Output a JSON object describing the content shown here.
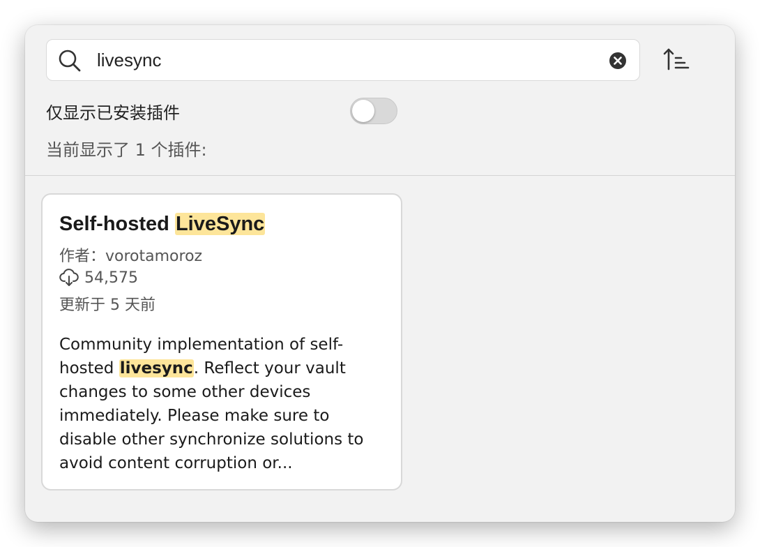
{
  "search": {
    "value": "livesync",
    "placeholder": ""
  },
  "filter": {
    "installed_only_label": "仅显示已安装插件",
    "installed_only_on": false
  },
  "result_count_text": "当前显示了 1 个插件:",
  "plugins": [
    {
      "title_prefix": "Self-hosted ",
      "title_highlight": "LiveSync",
      "author_label": "作者：",
      "author": "vorotamoroz",
      "downloads": "54,575",
      "updated": "更新于 5 天前",
      "description_before": "Community implementation of self-hosted ",
      "description_highlight": "livesync",
      "description_after": ". Reflect your vault changes to some other devices immediately. Please make sure to disable other synchronize solutions to avoid content corruption or..."
    }
  ],
  "colors": {
    "highlight": "#fde59a",
    "panel_background": "#f2f2f2",
    "card_border": "#d8d8d8",
    "toggle_off": "#d9d9d9"
  },
  "icons": {
    "search": "search-icon",
    "clear": "clear-circle-x-icon",
    "sort": "sort-ascending-icon",
    "downloads": "cloud-download-icon"
  }
}
